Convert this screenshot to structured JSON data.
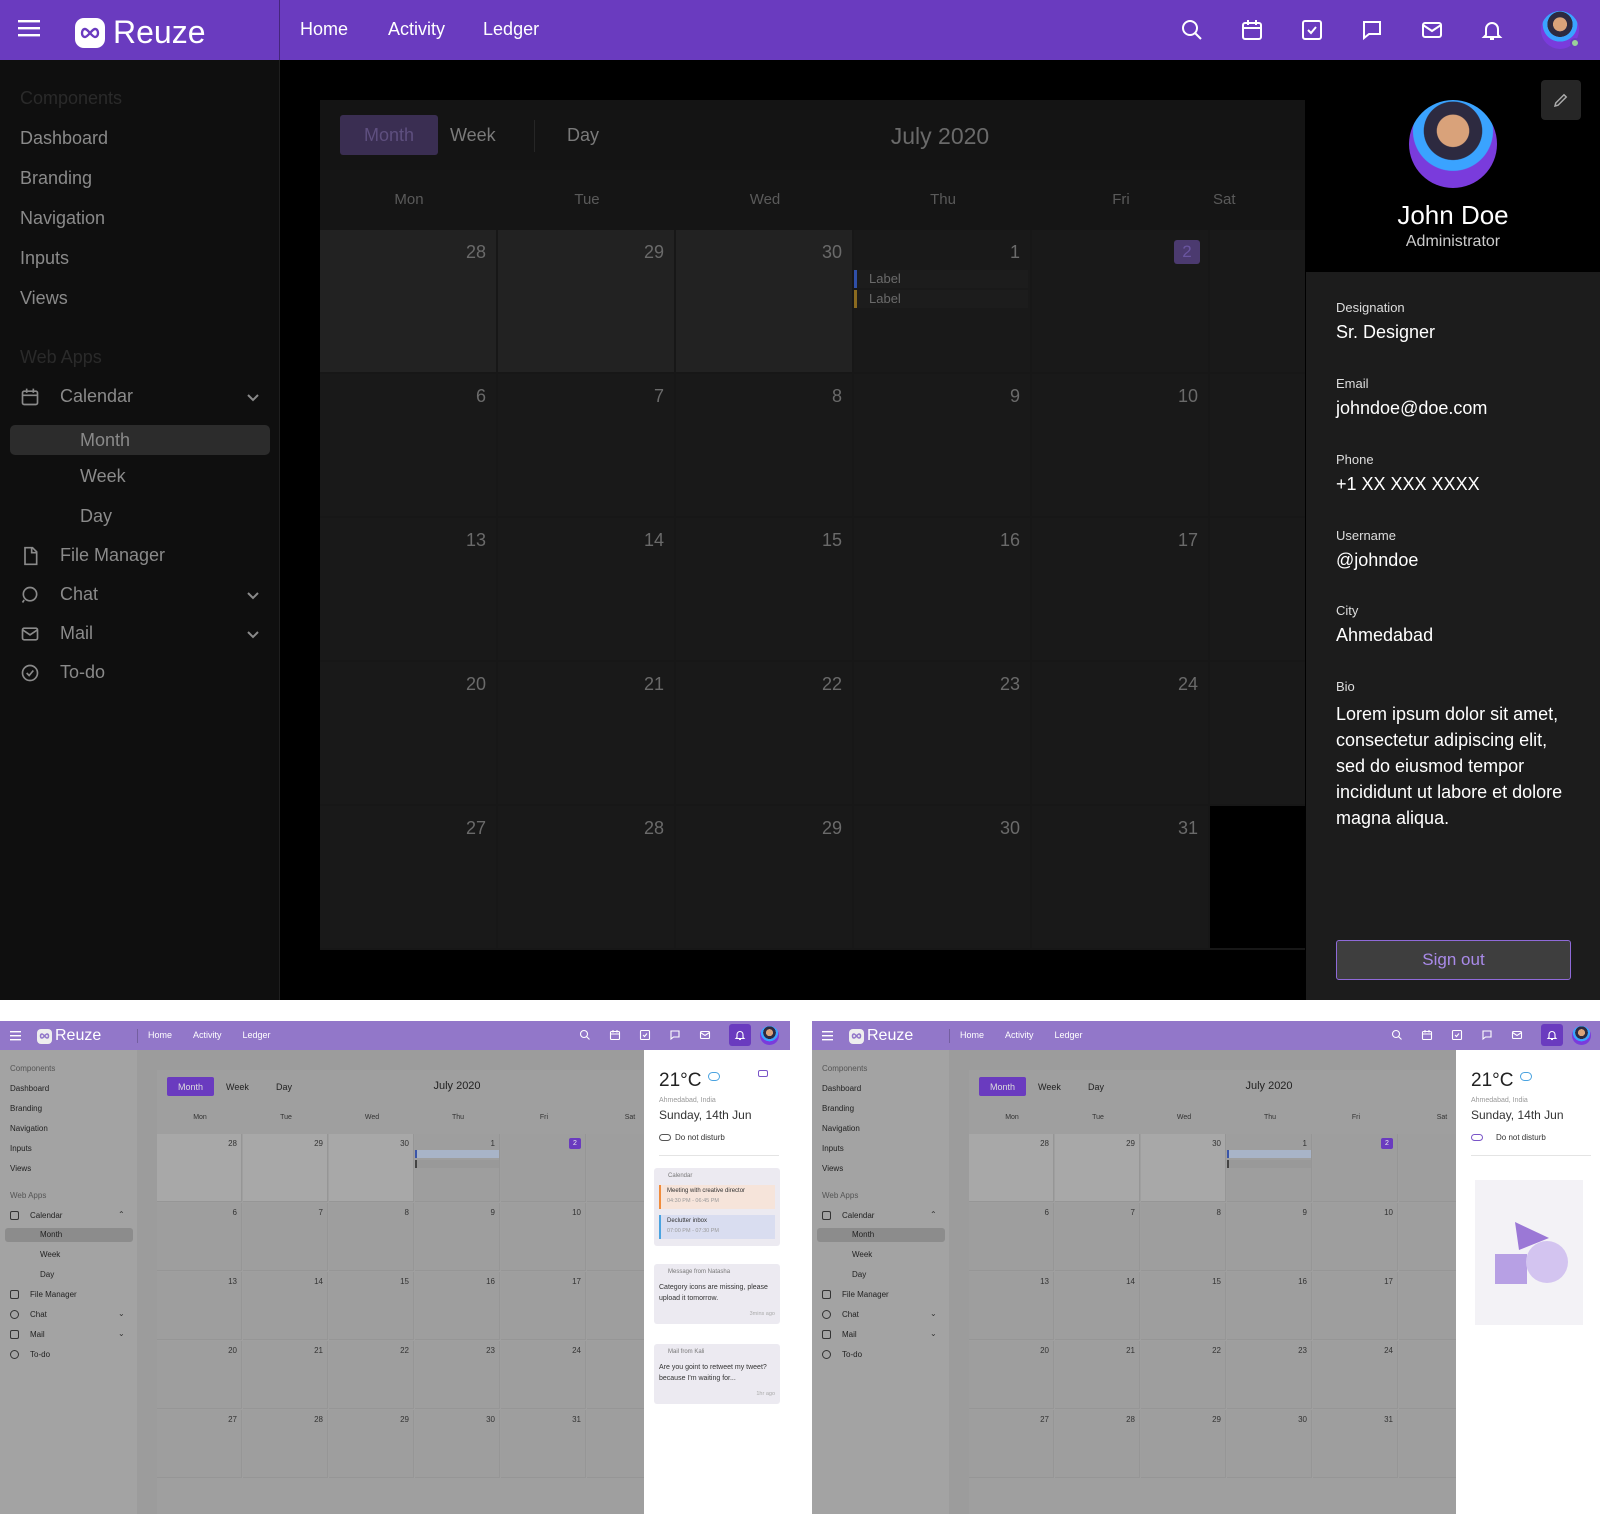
{
  "brand": {
    "name": "Reuze"
  },
  "nav": [
    "Home",
    "Activity",
    "Ledger"
  ],
  "icons": [
    "search-icon",
    "calendar-icon",
    "checkbox-icon",
    "chat-icon",
    "mail-icon",
    "bell-icon"
  ],
  "sidebar": {
    "section1": "Components",
    "items1": [
      "Dashboard",
      "Branding",
      "Navigation",
      "Inputs",
      "Views"
    ],
    "section2": "Web Apps",
    "calendar": "Calendar",
    "sub": [
      "Month",
      "Week",
      "Day"
    ],
    "file_manager": "File Manager",
    "chat": "Chat",
    "mail": "Mail",
    "todo": "To-do"
  },
  "calendar": {
    "views": [
      "Month",
      "Week",
      "Day"
    ],
    "active_view": "Month",
    "title": "July 2020",
    "days": [
      "Mon",
      "Tue",
      "Wed",
      "Thu",
      "Fri",
      "Sat"
    ],
    "weeks": [
      [
        "28",
        "29",
        "30",
        "1",
        "2",
        ""
      ],
      [
        "6",
        "7",
        "8",
        "9",
        "10",
        ""
      ],
      [
        "13",
        "14",
        "15",
        "16",
        "17",
        ""
      ],
      [
        "20",
        "21",
        "22",
        "23",
        "24",
        ""
      ],
      [
        "27",
        "28",
        "29",
        "30",
        "31",
        ""
      ]
    ],
    "today": "2",
    "event_labels": [
      "Label",
      "Label"
    ]
  },
  "profile": {
    "name": "John Doe",
    "role": "Administrator",
    "fields": [
      {
        "label": "Designation",
        "value": "Sr. Designer"
      },
      {
        "label": "Email",
        "value": "johndoe@doe.com"
      },
      {
        "label": "Phone",
        "value": "+1 XX XXX XXXX"
      },
      {
        "label": "Username",
        "value": "@johndoe"
      },
      {
        "label": "City",
        "value": "Ahmedabad"
      },
      {
        "label": "Bio",
        "value": "Lorem ipsum dolor sit amet, consectetur adipiscing elit, sed do eiusmod tempor incididunt ut labore et dolore magna aliqua."
      }
    ],
    "signout": "Sign out"
  },
  "notifications": {
    "temp": "21°C",
    "location": "Ahmedabad, India",
    "date": "Sunday, 14th Jun",
    "dnd": "Do not disturb",
    "calendar_title": "Calendar",
    "events": [
      {
        "title": "Meeting with creative director",
        "time": "04:30 PM - 06:45 PM"
      },
      {
        "title": "Declutter inbox",
        "time": "07:00 PM - 07:30 PM"
      }
    ],
    "message_title": "Message from Natasha",
    "message_body": "Category icons are missing, please upload it tomorrow.",
    "message_time": "3mins ago",
    "mail_title": "Mail from Kali",
    "mail_body": "Are you goint to retweet my tweet? because I'm waiting for...",
    "mail_time": "1hr ago"
  },
  "colors": {
    "brand": "#6a3bbf",
    "brand_light": "#9b78d6"
  }
}
